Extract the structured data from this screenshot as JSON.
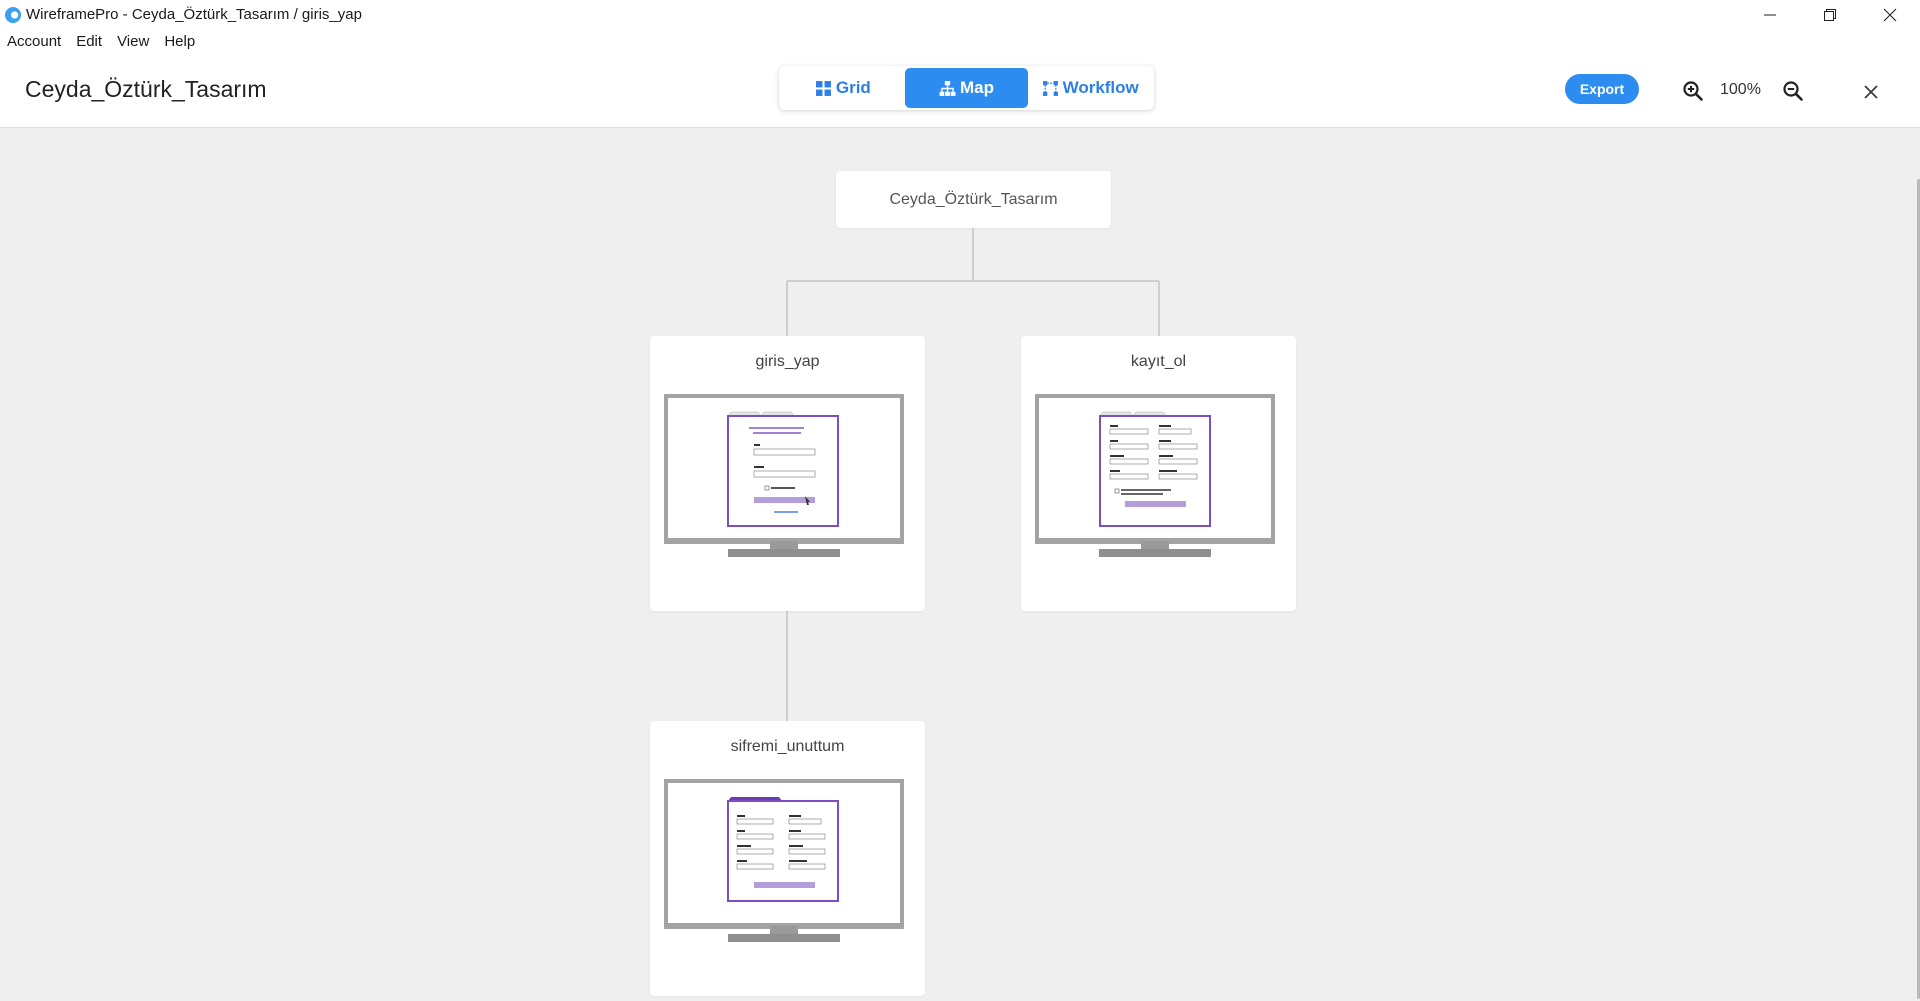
{
  "window": {
    "title": "WireframePro - Ceyda_Öztürk_Tasarım / giris_yap",
    "controls": [
      "minimize",
      "restore",
      "close"
    ]
  },
  "menu": {
    "items": [
      "Account",
      "Edit",
      "View",
      "Help"
    ]
  },
  "header": {
    "project_title": "Ceyda_Öztürk_Tasarım",
    "view_tabs": [
      {
        "label": "Grid",
        "icon": "grid-icon",
        "active": false
      },
      {
        "label": "Map",
        "icon": "sitemap-icon",
        "active": true
      },
      {
        "label": "Workflow",
        "icon": "workflow-icon",
        "active": false
      }
    ],
    "export_label": "Export",
    "zoom_level": "100%"
  },
  "map": {
    "root": {
      "label": "Ceyda_Öztürk_Tasarım"
    },
    "pages": [
      {
        "name": "giris_yap",
        "parent": "root"
      },
      {
        "name": "kayıt_ol",
        "parent": "root"
      },
      {
        "name": "sifremi_unuttum",
        "parent": "giris_yap"
      }
    ]
  },
  "colors": {
    "accent": "#2d8cf0",
    "canvas_bg": "#efefef",
    "wireframe_purple": "#7a4fc0",
    "monitor_gray": "#a3a3a3"
  }
}
